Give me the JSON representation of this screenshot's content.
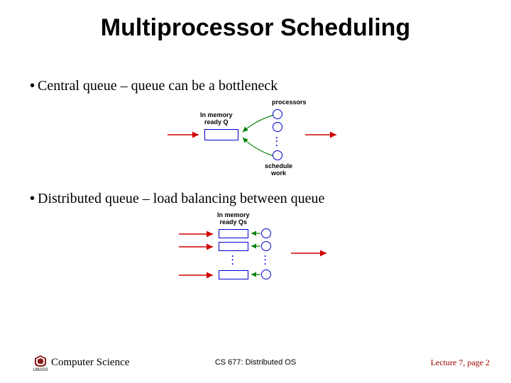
{
  "title": "Multiprocessor Scheduling",
  "bullets": {
    "b1": "Central queue – queue can be a bottleneck",
    "b2": "Distributed queue – load balancing between queue"
  },
  "diag1": {
    "processors": "processors",
    "ready_q_l1": "In memory",
    "ready_q_l2": "ready Q",
    "sched_l1": "schedule",
    "sched_l2": "work"
  },
  "diag2": {
    "ready_qs_l1": "In memory",
    "ready_qs_l2": "ready Qs"
  },
  "footer": {
    "umass": "UMASS",
    "dept": "Computer Science",
    "course": "CS 677: Distributed OS",
    "pager": "Lecture 7, page 2"
  }
}
